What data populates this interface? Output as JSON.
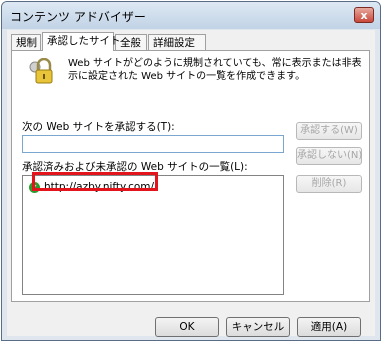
{
  "window": {
    "title": "コンテンツ アドバイザー",
    "close_glyph": "x"
  },
  "tabs": [
    {
      "label": "規制"
    },
    {
      "label": "承認したサイト"
    },
    {
      "label": "全般"
    },
    {
      "label": "詳細設定"
    }
  ],
  "description": "Web サイトがどのように規制されていても、常に表示または非表示に設定された Web サイトの一覧を作成できます。",
  "approve_field": {
    "label": "次の Web サイトを承認する(T):",
    "value": ""
  },
  "buttons": {
    "always": "承認する(W)",
    "never": "承認しない(N)",
    "remove": "削除(R)"
  },
  "list": {
    "label": "承認済みおよび未承認の Web サイトの一覧(L):",
    "items": [
      {
        "url": "http://azby.nifty.com/",
        "status_icon": "approved-check-icon"
      }
    ]
  },
  "footer": {
    "ok": "OK",
    "cancel": "キャンセル",
    "apply": "適用(A)"
  },
  "colors": {
    "highlight": "#e3141b",
    "approved": "#2d9b2d"
  }
}
